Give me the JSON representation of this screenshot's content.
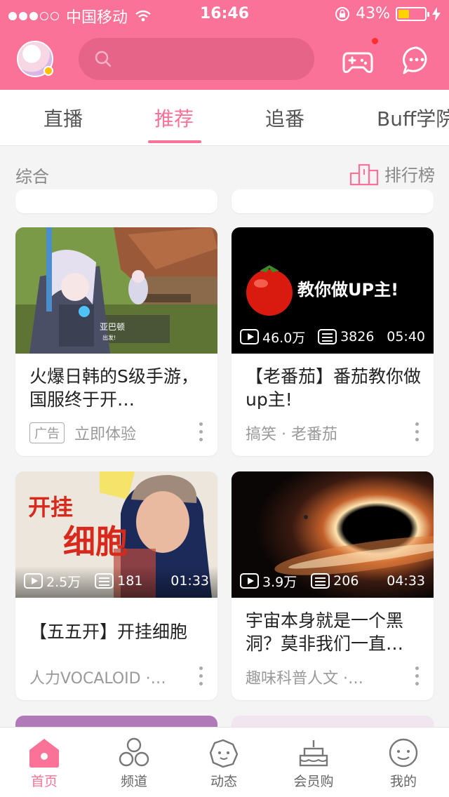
{
  "status_bar": {
    "carrier": "中国移动",
    "time": "16:46",
    "battery": "43%",
    "battery_level": 0.43
  },
  "header": {
    "search_placeholder": "",
    "game_badge": true
  },
  "tabs": [
    {
      "label": "直播",
      "active": false
    },
    {
      "label": "推荐",
      "active": true
    },
    {
      "label": "追番",
      "active": false
    },
    {
      "label": "Buff学院",
      "active": false
    }
  ],
  "section": {
    "title": "综合",
    "rank_label": "排行榜"
  },
  "cards": [
    {
      "title": "火爆日韩的S级手游，国服终于开…",
      "is_ad": true,
      "ad_label": "广告",
      "footer": "立即体验",
      "thumb_caption": "亚巴顿",
      "thumb_sub": "出发!"
    },
    {
      "title": "【老番茄】番茄教你做up主!",
      "views": "46.0万",
      "danmaku": "3826",
      "duration": "05:40",
      "footer": "搞笑 · 老番茄",
      "thumb_text": "教你做UP主!"
    },
    {
      "title": "【五五开】开挂细胞",
      "views": "2.5万",
      "danmaku": "181",
      "duration": "01:33",
      "footer": "人力VOCALOID ·…",
      "thumb_text_1": "开挂",
      "thumb_text_2": "细胞"
    },
    {
      "title": "宇宙本身就是一个黑洞？莫非我们一直…",
      "views": "3.9万",
      "danmaku": "206",
      "duration": "04:33",
      "footer": "趣味科普人文 ·…"
    }
  ],
  "bottom_nav": [
    {
      "label": "首页",
      "active": true
    },
    {
      "label": "频道",
      "active": false
    },
    {
      "label": "动态",
      "active": false
    },
    {
      "label": "会员购",
      "active": false
    },
    {
      "label": "我的",
      "active": false
    }
  ],
  "colors": {
    "accent": "#fb7299",
    "search_bg": "#e56487",
    "battery_fill": "#ffd400"
  }
}
